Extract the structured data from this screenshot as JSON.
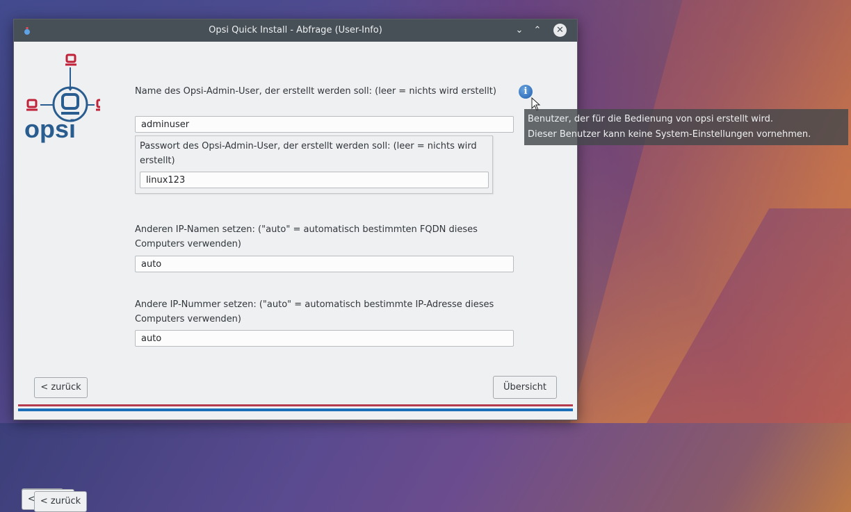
{
  "window": {
    "title": "Opsi Quick Install - Abfrage (User-Info)",
    "minimize_glyph": "⌄",
    "maximize_glyph": "⌃",
    "close_glyph": "✕"
  },
  "logo": {
    "text": "opsi"
  },
  "form": {
    "admin_user": {
      "label": "Name des Opsi-Admin-User, der erstellt werden soll: (leer = nichts wird erstellt)",
      "value": "adminuser"
    },
    "admin_password": {
      "label": "Passwort des Opsi-Admin-User, der erstellt werden soll: (leer = nichts wird erstellt)",
      "value": "linux123"
    },
    "ip_name": {
      "label": "Anderen IP-Namen setzen: (\"auto\" = automatisch bestimmten FQDN dieses Computers verwenden)",
      "value": "auto"
    },
    "ip_number": {
      "label": "Andere IP-Nummer setzen: (\"auto\" = automatisch bestimmte IP-Adresse dieses Computers verwenden)",
      "value": "auto"
    }
  },
  "tooltip": {
    "line1": "Benutzer, der für die Bedienung von opsi erstellt wird.",
    "line2": "Dieser Benutzer kann keine System-Einstellungen vornehmen."
  },
  "buttons": {
    "back": "< zurück",
    "overview": "Übersicht"
  },
  "colors": {
    "titlebar": "#475057",
    "stripe_red": "#b33b4d",
    "stripe_blue": "#1a6fb8",
    "logo_blue": "#2a5d8f",
    "logo_red": "#c0223a"
  }
}
